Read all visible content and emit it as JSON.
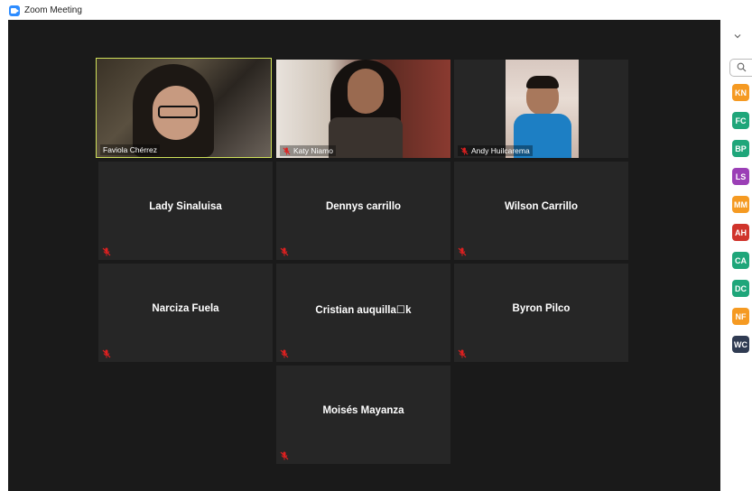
{
  "window": {
    "title": "Zoom Meeting"
  },
  "video_participants": [
    {
      "name": "Faviola Chérrez",
      "active": true,
      "muted": false
    },
    {
      "name": "Katy Niamo",
      "active": false,
      "muted": true
    },
    {
      "name": "Andy  Huilcarema",
      "active": false,
      "muted": true
    }
  ],
  "participants": [
    {
      "name": "Lady Sinaluisa"
    },
    {
      "name": "Dennys carrillo"
    },
    {
      "name": "Wilson Carrillo"
    },
    {
      "name": "Narciza Fuela"
    },
    {
      "name": "Cristian  auquilla☐k"
    },
    {
      "name": "Byron Pilco"
    },
    {
      "name": "Moisés Mayanza"
    }
  ],
  "sidebar": {
    "avatars": [
      {
        "initials": "KN",
        "color": "#f59a22"
      },
      {
        "initials": "FC",
        "color": "#1fa67a"
      },
      {
        "initials": "BP",
        "color": "#1fa67a"
      },
      {
        "initials": "LS",
        "color": "#9b3fb6"
      },
      {
        "initials": "MM",
        "color": "#f59a22"
      },
      {
        "initials": "AH",
        "color": "#d0342c"
      },
      {
        "initials": "CA",
        "color": "#1fa67a"
      },
      {
        "initials": "DC",
        "color": "#1fa67a"
      },
      {
        "initials": "NF",
        "color": "#f59a22"
      },
      {
        "initials": "WC",
        "color": "#2f3b52"
      }
    ]
  }
}
